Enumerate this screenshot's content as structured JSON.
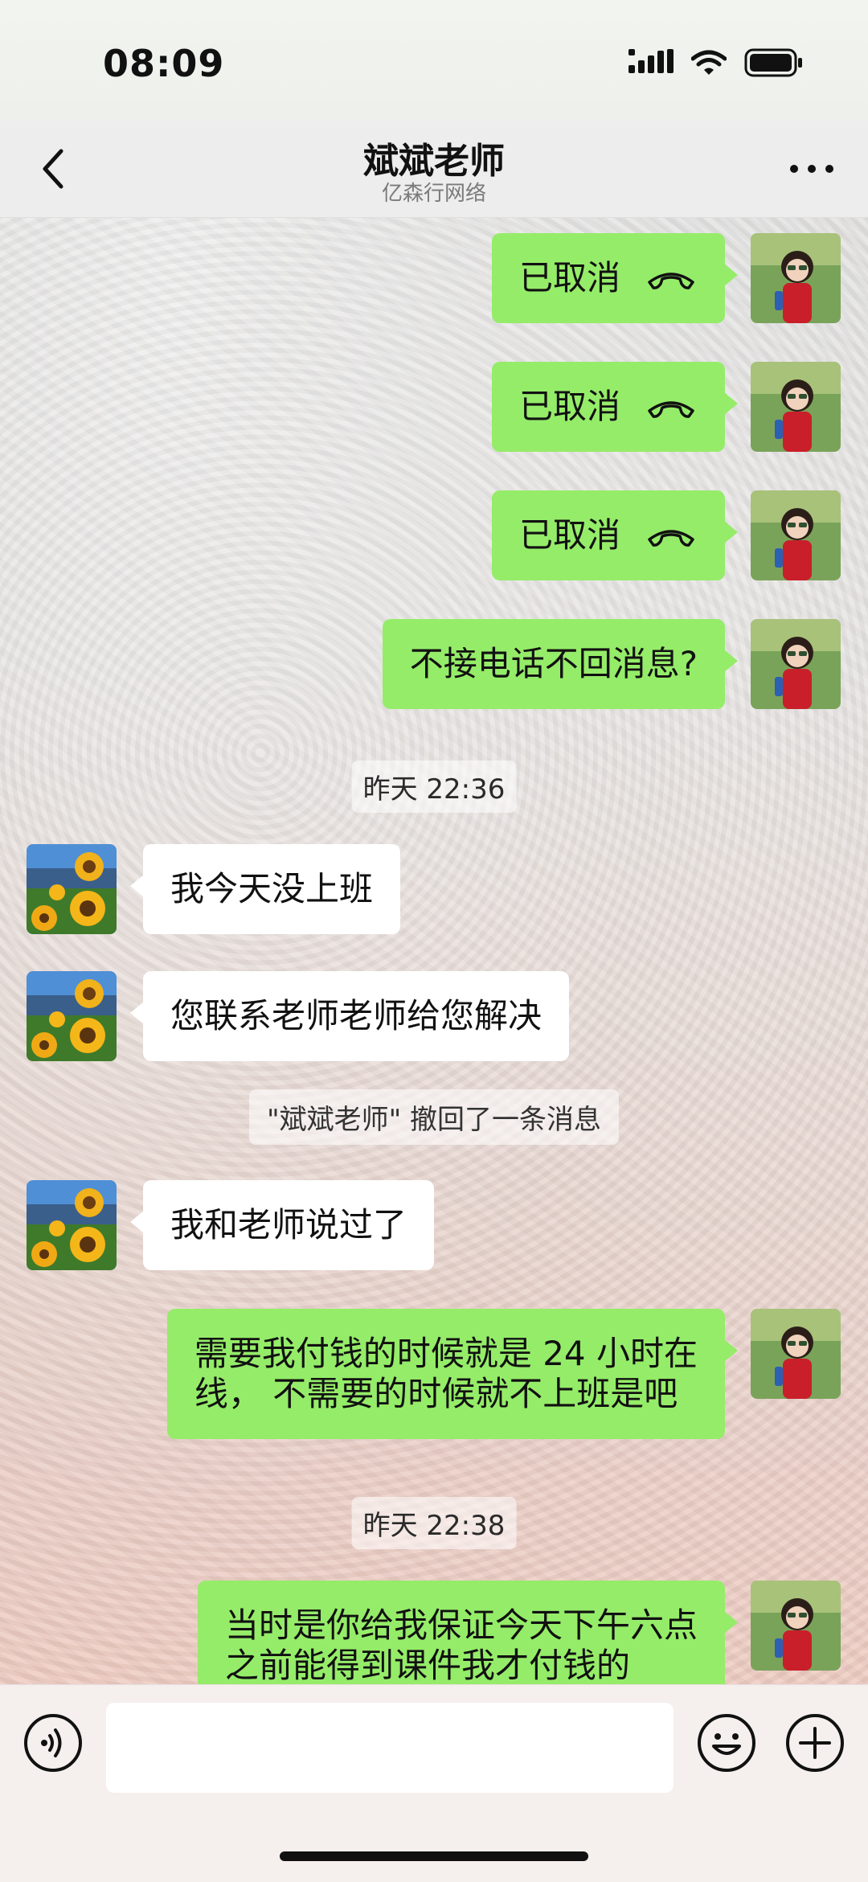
{
  "status_bar": {
    "time": "08:09"
  },
  "header": {
    "title": "斌斌老师",
    "subtitle": "亿森行网络"
  },
  "messages": [
    {
      "sender": "me",
      "type": "call",
      "text": "已取消"
    },
    {
      "sender": "me",
      "type": "call",
      "text": "已取消"
    },
    {
      "sender": "me",
      "type": "call",
      "text": "已取消"
    },
    {
      "sender": "me",
      "type": "text",
      "text": "不接电话不回消息?"
    },
    {
      "type": "timestamp",
      "text": "昨天 22:36"
    },
    {
      "sender": "them",
      "type": "text",
      "text": "我今天没上班"
    },
    {
      "sender": "them",
      "type": "text",
      "text": "您联系老师老师给您解决"
    },
    {
      "type": "system",
      "text": "\"斌斌老师\" 撤回了一条消息"
    },
    {
      "sender": "them",
      "type": "text",
      "text": "我和老师说过了"
    },
    {
      "sender": "me",
      "type": "text",
      "lines": [
        "需要我付钱的时候就是 24 小时在",
        "线， 不需要的时候就不上班是吧"
      ]
    },
    {
      "type": "timestamp",
      "text": "昨天 22:38"
    },
    {
      "sender": "me",
      "type": "text",
      "lines": [
        "当时是你给我保证今天下午六点",
        "之前能得到课件我才付钱的"
      ]
    }
  ],
  "input": {
    "value": "",
    "placeholder": ""
  },
  "icons": {
    "back": "chevron-left-icon",
    "more": "more-dots-icon",
    "call": "hangup-phone-icon",
    "voice": "voice-input-icon",
    "emoji": "emoji-icon",
    "plus": "plus-icon"
  },
  "colors": {
    "my_bubble": "#95ec69",
    "their_bubble": "#ffffff",
    "header_bg": "#ededed"
  }
}
